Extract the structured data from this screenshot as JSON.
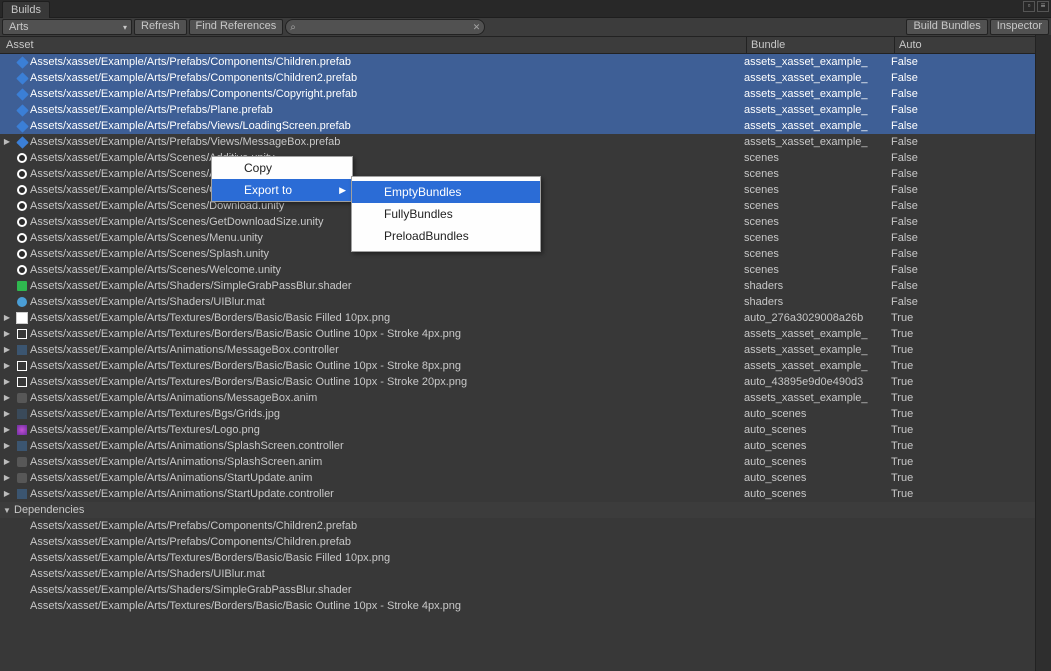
{
  "window": {
    "tab": "Builds"
  },
  "toolbar": {
    "dropdown_value": "Arts",
    "refresh": "Refresh",
    "find_refs": "Find References",
    "build_bundles": "Build Bundles",
    "inspector": "Inspector"
  },
  "headers": {
    "asset": "Asset",
    "bundle": "Bundle",
    "auto": "Auto"
  },
  "rows": [
    {
      "sel": true,
      "expand": false,
      "icon": "prefab",
      "asset": "Assets/xasset/Example/Arts/Prefabs/Components/Children.prefab",
      "bundle": "assets_xasset_example_",
      "auto": "False"
    },
    {
      "sel": true,
      "expand": false,
      "icon": "prefab",
      "asset": "Assets/xasset/Example/Arts/Prefabs/Components/Children2.prefab",
      "bundle": "assets_xasset_example_",
      "auto": "False"
    },
    {
      "sel": true,
      "expand": false,
      "icon": "prefab",
      "asset": "Assets/xasset/Example/Arts/Prefabs/Components/Copyright.prefab",
      "bundle": "assets_xasset_example_",
      "auto": "False"
    },
    {
      "sel": true,
      "expand": false,
      "icon": "prefab",
      "asset": "Assets/xasset/Example/Arts/Prefabs/Plane.prefab",
      "bundle": "assets_xasset_example_",
      "auto": "False"
    },
    {
      "sel": true,
      "expand": false,
      "icon": "prefab",
      "asset": "Assets/xasset/Example/Arts/Prefabs/Views/LoadingScreen.prefab",
      "bundle": "assets_xasset_example_",
      "auto": "False"
    },
    {
      "sel": false,
      "expand": true,
      "icon": "prefab",
      "asset": "Assets/xasset/Example/Arts/Prefabs/Views/MessageBox.prefab",
      "bundle": "assets_xasset_example_",
      "auto": "False"
    },
    {
      "sel": false,
      "expand": false,
      "icon": "unity",
      "asset": "Assets/xasset/Example/Arts/Scenes/Additive.unity",
      "bundle": "scenes",
      "auto": "False"
    },
    {
      "sel": false,
      "expand": false,
      "icon": "unity",
      "asset": "Assets/xasset/Example/Arts/Scenes/Async2Sync.unity",
      "bundle": "scenes",
      "auto": "False"
    },
    {
      "sel": false,
      "expand": false,
      "icon": "unity",
      "asset": "Assets/xasset/Example/Arts/Scenes/Childrens.unity",
      "bundle": "scenes",
      "auto": "False"
    },
    {
      "sel": false,
      "expand": false,
      "icon": "unity",
      "asset": "Assets/xasset/Example/Arts/Scenes/Download.unity",
      "bundle": "scenes",
      "auto": "False"
    },
    {
      "sel": false,
      "expand": false,
      "icon": "unity",
      "asset": "Assets/xasset/Example/Arts/Scenes/GetDownloadSize.unity",
      "bundle": "scenes",
      "auto": "False"
    },
    {
      "sel": false,
      "expand": false,
      "icon": "unity",
      "asset": "Assets/xasset/Example/Arts/Scenes/Menu.unity",
      "bundle": "scenes",
      "auto": "False"
    },
    {
      "sel": false,
      "expand": false,
      "icon": "unity",
      "asset": "Assets/xasset/Example/Arts/Scenes/Splash.unity",
      "bundle": "scenes",
      "auto": "False"
    },
    {
      "sel": false,
      "expand": false,
      "icon": "unity",
      "asset": "Assets/xasset/Example/Arts/Scenes/Welcome.unity",
      "bundle": "scenes",
      "auto": "False"
    },
    {
      "sel": false,
      "expand": false,
      "icon": "shader",
      "asset": "Assets/xasset/Example/Arts/Shaders/SimpleGrabPassBlur.shader",
      "bundle": "shaders",
      "auto": "False"
    },
    {
      "sel": false,
      "expand": false,
      "icon": "mat",
      "asset": "Assets/xasset/Example/Arts/Shaders/UIBlur.mat",
      "bundle": "shaders",
      "auto": "False"
    },
    {
      "sel": false,
      "expand": true,
      "icon": "png-fill",
      "asset": "Assets/xasset/Example/Arts/Textures/Borders/Basic/Basic Filled 10px.png",
      "bundle": "auto_276a3029008a26b",
      "auto": "True"
    },
    {
      "sel": false,
      "expand": true,
      "icon": "png-out",
      "asset": "Assets/xasset/Example/Arts/Textures/Borders/Basic/Basic Outline 10px - Stroke 4px.png",
      "bundle": "assets_xasset_example_",
      "auto": "True"
    },
    {
      "sel": false,
      "expand": true,
      "icon": "ctrl",
      "asset": "Assets/xasset/Example/Arts/Animations/MessageBox.controller",
      "bundle": "assets_xasset_example_",
      "auto": "True"
    },
    {
      "sel": false,
      "expand": true,
      "icon": "png-out",
      "asset": "Assets/xasset/Example/Arts/Textures/Borders/Basic/Basic Outline 10px - Stroke 8px.png",
      "bundle": "assets_xasset_example_",
      "auto": "True"
    },
    {
      "sel": false,
      "expand": true,
      "icon": "png-out",
      "asset": "Assets/xasset/Example/Arts/Textures/Borders/Basic/Basic Outline 10px - Stroke 20px.png",
      "bundle": "auto_43895e9d0e490d3",
      "auto": "True"
    },
    {
      "sel": false,
      "expand": true,
      "icon": "anim",
      "asset": "Assets/xasset/Example/Arts/Animations/MessageBox.anim",
      "bundle": "assets_xasset_example_",
      "auto": "True"
    },
    {
      "sel": false,
      "expand": true,
      "icon": "jpg",
      "asset": "Assets/xasset/Example/Arts/Textures/Bgs/Grids.jpg",
      "bundle": "auto_scenes",
      "auto": "True"
    },
    {
      "sel": false,
      "expand": true,
      "icon": "logo",
      "asset": "Assets/xasset/Example/Arts/Textures/Logo.png",
      "bundle": "auto_scenes",
      "auto": "True"
    },
    {
      "sel": false,
      "expand": true,
      "icon": "ctrl",
      "asset": "Assets/xasset/Example/Arts/Animations/SplashScreen.controller",
      "bundle": "auto_scenes",
      "auto": "True"
    },
    {
      "sel": false,
      "expand": true,
      "icon": "anim",
      "asset": "Assets/xasset/Example/Arts/Animations/SplashScreen.anim",
      "bundle": "auto_scenes",
      "auto": "True"
    },
    {
      "sel": false,
      "expand": true,
      "icon": "anim",
      "asset": "Assets/xasset/Example/Arts/Animations/StartUpdate.anim",
      "bundle": "auto_scenes",
      "auto": "True"
    },
    {
      "sel": false,
      "expand": true,
      "icon": "ctrl",
      "asset": "Assets/xasset/Example/Arts/Animations/StartUpdate.controller",
      "bundle": "auto_scenes",
      "auto": "True"
    }
  ],
  "deps": {
    "title": "Dependencies",
    "items": [
      "Assets/xasset/Example/Arts/Prefabs/Components/Children2.prefab",
      "Assets/xasset/Example/Arts/Prefabs/Components/Children.prefab",
      "Assets/xasset/Example/Arts/Textures/Borders/Basic/Basic Filled 10px.png",
      "Assets/xasset/Example/Arts/Shaders/UIBlur.mat",
      "Assets/xasset/Example/Arts/Shaders/SimpleGrabPassBlur.shader",
      "Assets/xasset/Example/Arts/Textures/Borders/Basic/Basic Outline 10px - Stroke 4px.png"
    ]
  },
  "ctx": {
    "copy": "Copy",
    "export_to": "Export to"
  },
  "sub": {
    "empty": "EmptyBundles",
    "fully": "FullyBundles",
    "preload": "PreloadBundles"
  }
}
